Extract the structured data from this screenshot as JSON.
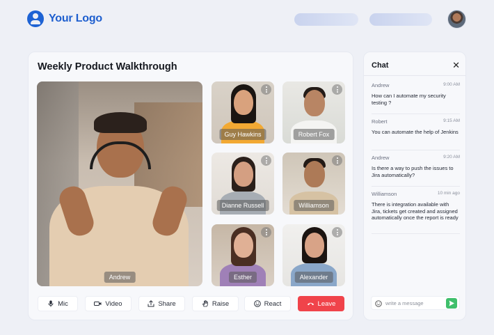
{
  "logo": {
    "text": "Your Logo",
    "icon": "user-circle-icon",
    "color": "#1e63d4"
  },
  "meeting": {
    "title": "Weekly Product Walkthrough"
  },
  "participants": {
    "main": {
      "name": "Andrew"
    },
    "grid": [
      {
        "name": "Guy Hawkins"
      },
      {
        "name": "Robert Fox"
      },
      {
        "name": "Dianne Russell"
      },
      {
        "name": "Williamson"
      },
      {
        "name": "Esther"
      },
      {
        "name": "Alexander"
      }
    ]
  },
  "controls": {
    "mic": {
      "label": "Mic",
      "icon": "microphone-icon"
    },
    "video": {
      "label": "Video",
      "icon": "video-camera-icon"
    },
    "share": {
      "label": "Share",
      "icon": "share-upload-icon"
    },
    "raise": {
      "label": "Raise",
      "icon": "hand-icon"
    },
    "react": {
      "label": "React",
      "icon": "smiley-icon"
    },
    "leave": {
      "label": "Leave",
      "icon": "phone-hangup-icon",
      "color": "#f0434a"
    }
  },
  "chat": {
    "title": "Chat",
    "messages": [
      {
        "author": "Andrew",
        "time": "9:00 AM",
        "text": "How can I automate my security testing ?"
      },
      {
        "author": "Robert",
        "time": "9:15 AM",
        "text": "You can automate the help of Jenkins"
      },
      {
        "author": "Andrew",
        "time": "9:20 AM",
        "text": "Is there a way to push the issues to Jira automatically?"
      },
      {
        "author": "Williamson",
        "time": "10 min ago",
        "text": "There is integration available with Jira, tickets get created and assigned automatically once the report is ready"
      }
    ],
    "input": {
      "placeholder": "write a message",
      "value": ""
    },
    "send_color": "#3fbf6b"
  }
}
